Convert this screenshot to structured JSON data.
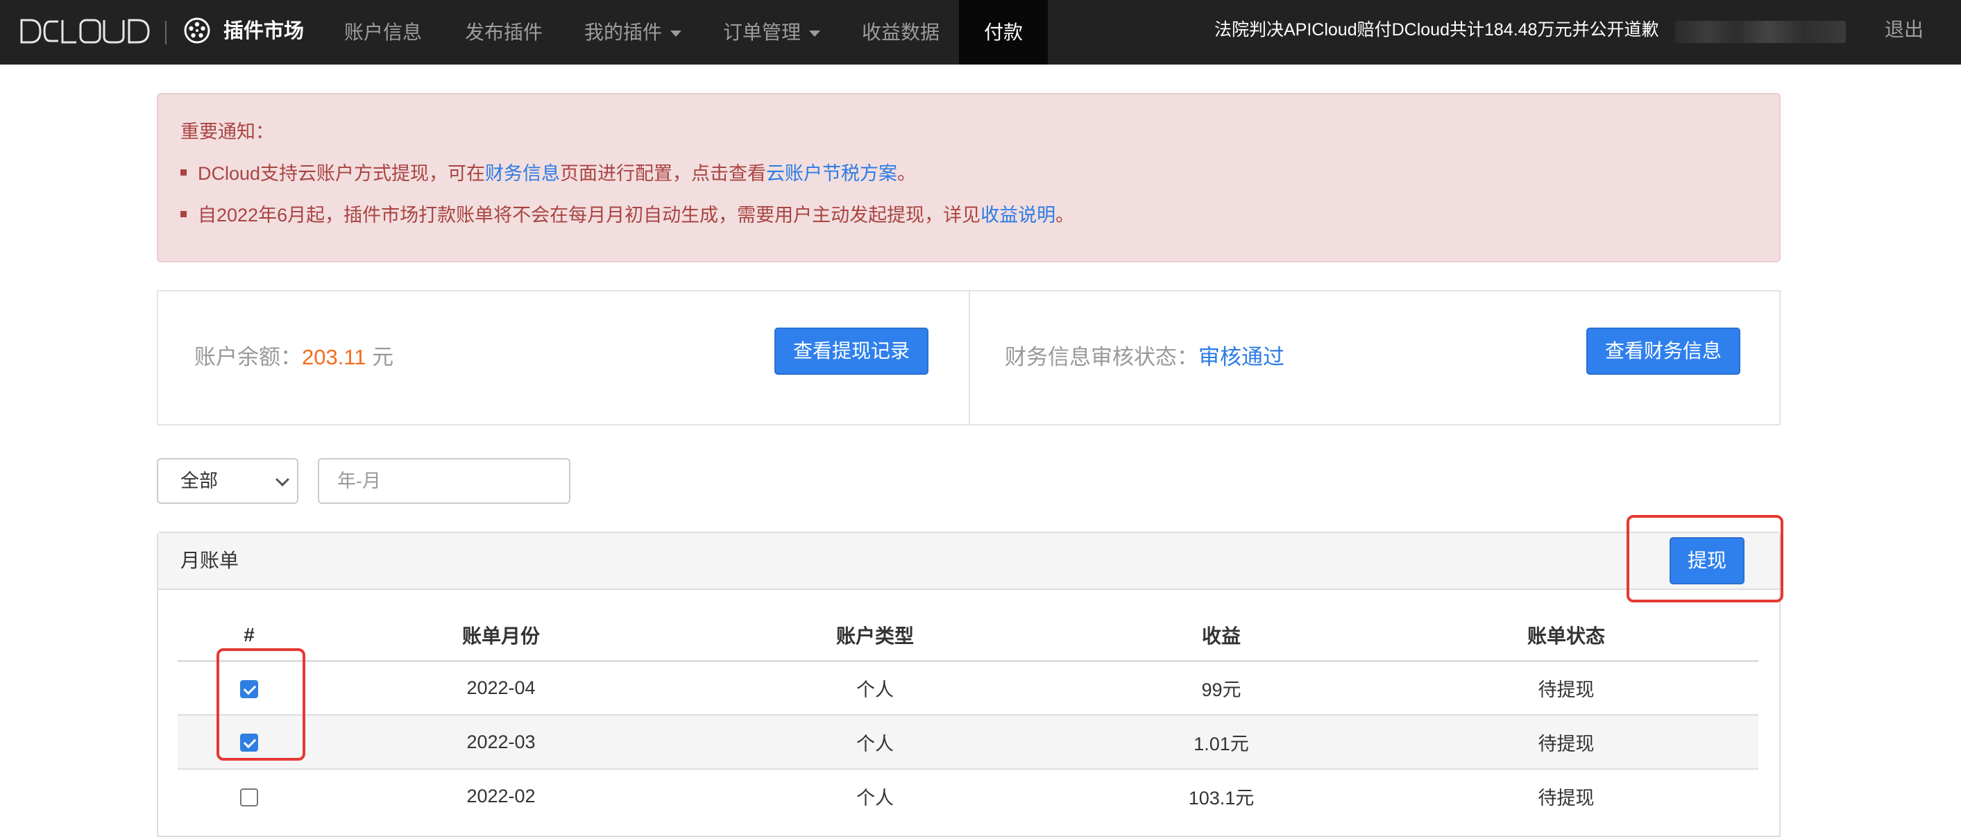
{
  "nav": {
    "brand": "DCLOUD",
    "market_title": "插件市场",
    "items": [
      {
        "label": "账户信息"
      },
      {
        "label": "发布插件"
      },
      {
        "label": "我的插件"
      },
      {
        "label": "订单管理"
      },
      {
        "label": "收益数据"
      },
      {
        "label": "付款"
      }
    ],
    "notice": "法院判决APICloud赔付DCloud共计184.48万元并公开道歉",
    "logout": "退出"
  },
  "alert": {
    "title": "重要通知：",
    "item1": {
      "pre": "DCloud支持云账户方式提现，可在",
      "link1": "财务信息",
      "mid": "页面进行配置，点击查看",
      "link2": "云账户节税方案",
      "post": "。"
    },
    "item2": {
      "pre": "自2022年6月起，插件市场打款账单将不会在每月月初自动生成，需要用户主动发起提现，详见",
      "link": "收益说明",
      "post": "。"
    }
  },
  "account": {
    "balance_label": "账户余额：",
    "balance_value": "203.11",
    "balance_unit": "元",
    "withdraw_record_button": "查看提现记录",
    "audit_label": "财务信息审核状态：",
    "audit_status": "审核通过",
    "finance_info_button": "查看财务信息"
  },
  "filters": {
    "type_selected": "全部",
    "month_placeholder": "年-月"
  },
  "bills": {
    "title": "月账单",
    "withdraw_button": "提现",
    "columns": [
      "#",
      "账单月份",
      "账户类型",
      "收益",
      "账单状态"
    ],
    "rows": [
      {
        "checked": true,
        "month": "2022-04",
        "type": "个人",
        "income": "99元",
        "status": "待提现"
      },
      {
        "checked": true,
        "month": "2022-03",
        "type": "个人",
        "income": "1.01元",
        "status": "待提现"
      },
      {
        "checked": false,
        "month": "2022-02",
        "type": "个人",
        "income": "103.1元",
        "status": "待提现"
      }
    ]
  },
  "colors": {
    "navbar": "#222222",
    "primary": "#2f80ed",
    "alert_text": "#a94442",
    "amount": "#f36c21",
    "highlight": "#e53935"
  }
}
